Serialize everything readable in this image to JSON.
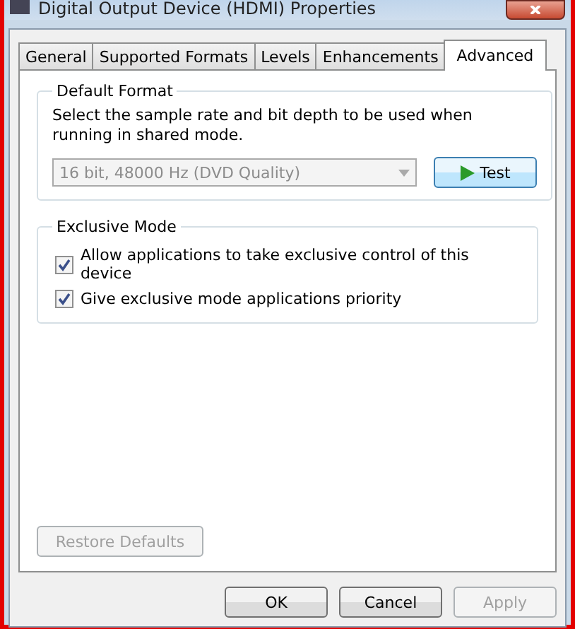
{
  "window": {
    "title": "Digital Output Device (HDMI) Properties"
  },
  "tabs": [
    {
      "label": "General",
      "selected": false
    },
    {
      "label": "Supported Formats",
      "selected": false
    },
    {
      "label": "Levels",
      "selected": false
    },
    {
      "label": "Enhancements",
      "selected": false
    },
    {
      "label": "Advanced",
      "selected": true
    }
  ],
  "default_format": {
    "title": "Default Format",
    "description": "Select the sample rate and bit depth to be used when running in shared mode.",
    "dropdown": {
      "value": "16 bit, 48000 Hz (DVD Quality)",
      "disabled": true
    },
    "test_button": {
      "label": "Test",
      "disabled": false
    }
  },
  "exclusive_mode": {
    "title": "Exclusive Mode",
    "options": [
      {
        "label": "Allow applications to take exclusive control of this device",
        "checked": true
      },
      {
        "label": "Give exclusive mode applications priority",
        "checked": true
      }
    ]
  },
  "restore_button": {
    "label": "Restore Defaults",
    "disabled": true
  },
  "buttons": [
    {
      "label": "OK",
      "disabled": false
    },
    {
      "label": "Cancel",
      "disabled": false
    },
    {
      "label": "Apply",
      "disabled": true
    }
  ]
}
